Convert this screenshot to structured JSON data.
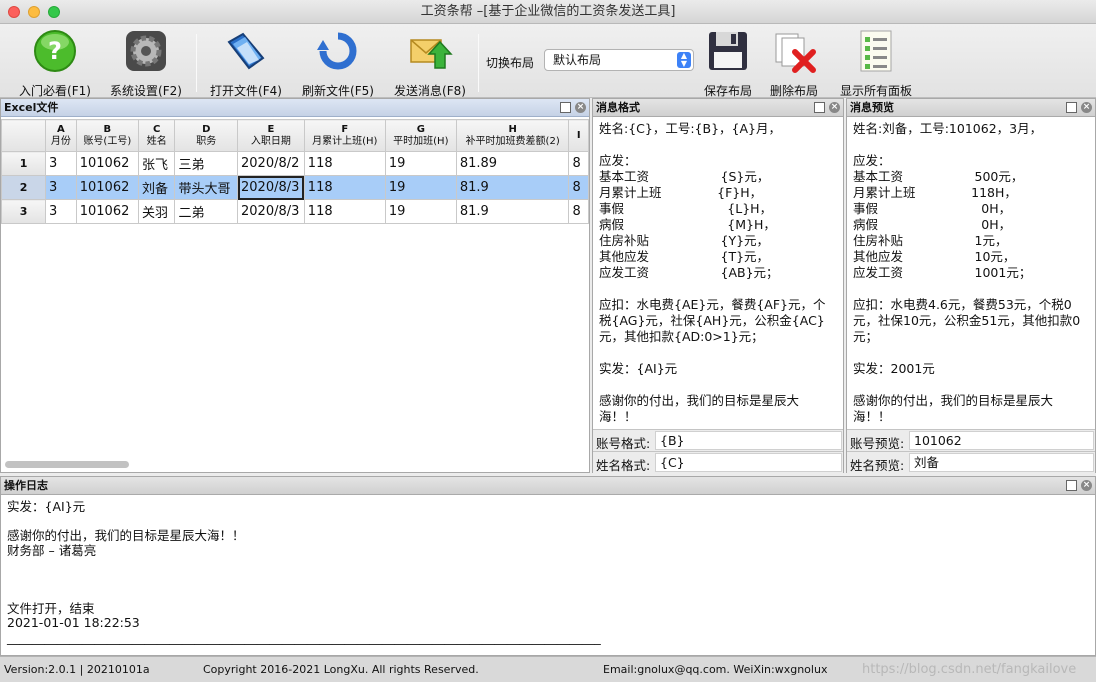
{
  "window": {
    "title": "工资条帮 –[基于企业微信的工资条发送工具]"
  },
  "toolbar": {
    "buttons": [
      {
        "label": "入门必看(F1)",
        "icon": "help-icon"
      },
      {
        "label": "系统设置(F2)",
        "icon": "gear-icon"
      },
      {
        "label": "打开文件(F4)",
        "icon": "folder-icon"
      },
      {
        "label": "刷新文件(F5)",
        "icon": "refresh-icon"
      },
      {
        "label": "发送消息(F8)",
        "icon": "send-mail-icon"
      },
      {
        "label": "保存布局",
        "icon": "floppy-icon"
      },
      {
        "label": "删除布局",
        "icon": "delete-docs-icon"
      },
      {
        "label": "显示所有面板",
        "icon": "checklist-icon"
      }
    ],
    "layout_label": "切换布局",
    "layout_value": "默认布局"
  },
  "excel_panel": {
    "title": "Excel文件",
    "columns": [
      {
        "letter": "A",
        "name": "月份"
      },
      {
        "letter": "B",
        "name": "账号(工号)"
      },
      {
        "letter": "C",
        "name": "姓名"
      },
      {
        "letter": "D",
        "name": "职务"
      },
      {
        "letter": "E",
        "name": "入职日期"
      },
      {
        "letter": "F",
        "name": "月累计上班(H)"
      },
      {
        "letter": "G",
        "name": "平时加班(H)"
      },
      {
        "letter": "H",
        "name": "补平时加班费差额(2)"
      },
      {
        "letter": "I",
        "name": ""
      }
    ],
    "rows": [
      {
        "num": "1",
        "cells": [
          "3",
          "101062",
          "张飞",
          "三弟",
          "2020/8/2",
          "118",
          "19",
          "81.89",
          "8"
        ]
      },
      {
        "num": "2",
        "cells": [
          "3",
          "101062",
          "刘备",
          "带头大哥",
          "2020/8/3",
          "118",
          "19",
          "81.9",
          "8"
        ]
      },
      {
        "num": "3",
        "cells": [
          "3",
          "101062",
          "关羽",
          "二弟",
          "2020/8/3",
          "118",
          "19",
          "81.9",
          "8"
        ]
      }
    ]
  },
  "format_panel": {
    "title": "消息格式",
    "text": "姓名:{C}，工号:{B}，{A}月，\n\n应发：\n基本工资                  {S}元，\n月累计上班              {F}H，\n事假                          {L}H，\n病假                          {M}H，\n住房补贴                  {Y}元，\n其他应发                  {T}元，\n应发工资                  {AB}元；\n\n应扣：水电费{AE}元，餐费{AF}元，个\n税{AG}元，社保{AH}元，公积金{AC}\n元，其他扣款{AD:0>1}元；\n\n实发：{AI}元\n\n感谢你的付出，我们的目标是星辰大\n海！！\n财务部 – 诸葛亮",
    "account_label": "账号格式:",
    "account_value": "{B}",
    "name_label": "姓名格式:",
    "name_value": "{C}"
  },
  "preview_panel": {
    "title": "消息预览",
    "text": "姓名:刘备，工号:101062，3月，\n\n应发：\n基本工资                  500元，\n月累计上班              118H，\n事假                          0H，\n病假                          0H，\n住房补贴                  1元，\n其他应发                  10元，\n应发工资                  1001元；\n\n应扣：水电费4.6元，餐费53元，个税0\n元，社保10元，公积金51元，其他扣款0\n元；\n\n实发：2001元\n\n感谢你的付出，我们的目标是星辰大\n海！！\n财务部 – 诸葛亮",
    "account_label": "账号预览:",
    "account_value": "101062",
    "name_label": "姓名预览:",
    "name_value": "刘备"
  },
  "log_panel": {
    "title": "操作日志",
    "text": "实发：{AI}元\n\n感谢你的付出，我们的目标是星辰大海！！\n财务部 – 诸葛亮\n\n\n\n文件打开，结束\n2021-01-01 18:22:53\n_______________________________________________________________________________________________"
  },
  "status": {
    "version": "Version:2.0.1 | 20210101a",
    "copyright": "Copyright 2016-2021 LongXu. All rights Reserved.",
    "contact": "Email:gnolux@qq.com.  WeiXin:wxgnolux",
    "watermark": "https://blog.csdn.net/fangkailove"
  },
  "colors": {
    "selection": "#a8cdf8",
    "panel_header": "#c6d2e6"
  }
}
